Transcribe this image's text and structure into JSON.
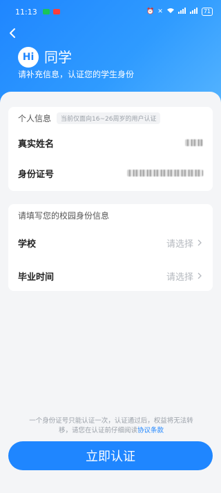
{
  "status_bar": {
    "time": "11:13",
    "battery": "71",
    "app_icon_colors": [
      "#19c55a",
      "#ff3d3d"
    ]
  },
  "header": {
    "hi_badge": "Hi",
    "title": "同学",
    "subtitle": "请补充信息，认证您的学生身份"
  },
  "personal_info": {
    "title": "个人信息",
    "tag": "当前仅面向16~26周岁的用户认证",
    "fields": [
      {
        "label": "真实姓名",
        "value_masked": true
      },
      {
        "label": "身份证号",
        "value_masked": true
      }
    ]
  },
  "campus_info": {
    "title": "请填写您的校园身份信息",
    "fields": [
      {
        "label": "学校",
        "placeholder": "请选择"
      },
      {
        "label": "毕业时间",
        "placeholder": "请选择"
      }
    ]
  },
  "footer": {
    "note": "一个身份证号只能认证一次，认证通过后，权益将无法转移，请您在认证前仔细阅读",
    "link": "协议条款"
  },
  "submit": {
    "label": "立即认证"
  },
  "colors": {
    "accent": "#1f86ff",
    "background": "#f4f5f7"
  }
}
